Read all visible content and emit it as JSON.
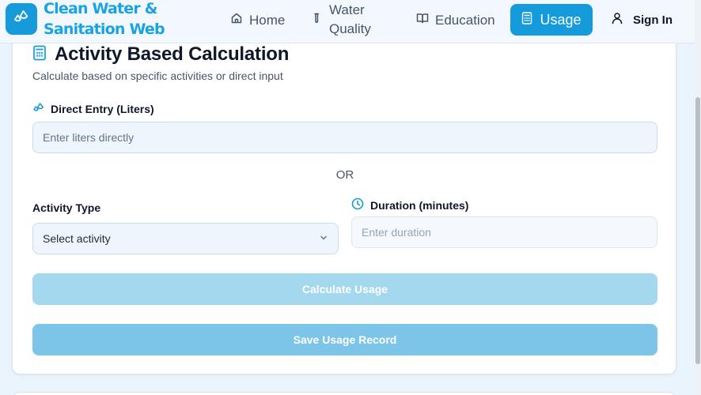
{
  "header": {
    "brand": "Clean Water & Sanitation Web",
    "nav": {
      "home": "Home",
      "water_quality_line1": "Water",
      "water_quality_line2": "Quality",
      "education": "Education",
      "usage": "Usage"
    },
    "sign_in": "Sign In"
  },
  "card": {
    "title": "Activity Based Calculation",
    "subtitle": "Calculate based on specific activities or direct input",
    "direct_entry_label": "Direct Entry (Liters)",
    "direct_entry_placeholder": "Enter liters directly",
    "or_text": "OR",
    "activity_type_label": "Activity Type",
    "activity_select_value": "Select activity",
    "duration_label": "Duration (minutes)",
    "duration_placeholder": "Enter duration",
    "calculate_button": "Calculate Usage",
    "save_button": "Save Usage Record"
  },
  "colors": {
    "accent": "#159bdb",
    "calc_button": "#a3d8ee",
    "save_button": "#7cc4e8"
  },
  "icons": {
    "logo": "droplets-icon",
    "home": "home-icon",
    "water_quality": "test-tube-icon",
    "education": "book-open-icon",
    "usage": "calculator-icon",
    "sign_in": "user-icon",
    "title": "calculator-icon",
    "direct_entry": "droplets-icon",
    "duration": "clock-icon",
    "select": "chevron-down-icon"
  }
}
